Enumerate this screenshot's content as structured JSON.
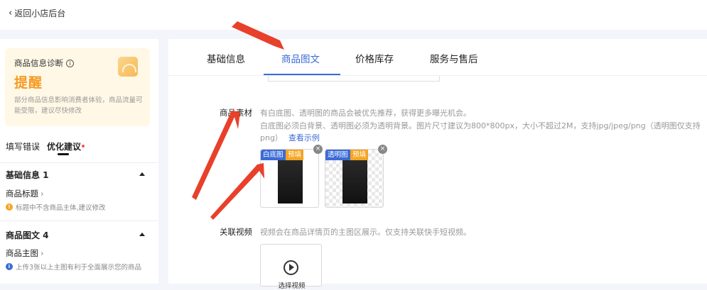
{
  "header": {
    "back_label": "返回小店后台"
  },
  "diagnosis": {
    "title": "商品信息诊断",
    "info_icon": "i",
    "remind": "提醒",
    "desc": "部分商品信息影响消费者体验，商品流量可能受限，建议尽快修改"
  },
  "side_tabs": {
    "left": "填写错误",
    "right": "优化建议"
  },
  "sections": [
    {
      "head": "基础信息 1",
      "item": "商品标题",
      "note": "标题中不含商品主体,建议修改"
    },
    {
      "head": "商品图文 4",
      "item": "商品主图",
      "note": "上传3张以上主图有利于全面展示您的商品"
    }
  ],
  "tabs": [
    "基础信息",
    "商品图文",
    "价格库存",
    "服务与售后"
  ],
  "material": {
    "label": "商品素材",
    "hint1": "有白底图、透明图的商品会被优先推荐，获得更多曝光机会。",
    "hint2": "白底图必须白背景、透明图必须为透明背景。图片尺寸建议为800*800px，大小不超过2M，支持jpg/jpeg/png（透明图仅支持",
    "hint3": "png）",
    "link": "查看示例",
    "thumbs": [
      {
        "tag": "白底图",
        "fill": "预填"
      },
      {
        "tag": "透明图",
        "fill": "预填"
      }
    ],
    "close_symbol": "×"
  },
  "video": {
    "label": "关联视频",
    "hint": "视频会在商品详情页的主图区展示。仅支持关联快手短视频。",
    "button": "选择视频"
  },
  "colors": {
    "accent": "#3b6bd6",
    "warning": "#f59a23",
    "arrow": "#e8402a"
  }
}
